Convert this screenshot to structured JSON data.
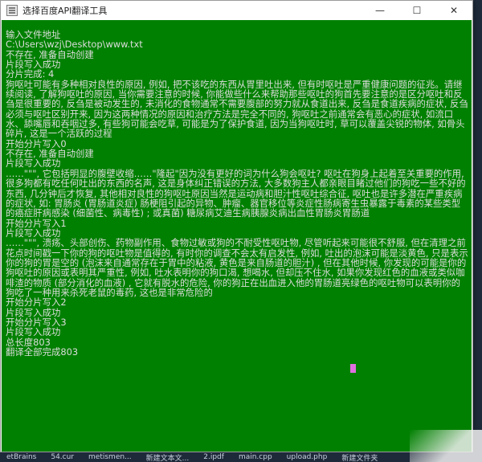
{
  "window": {
    "title": "选择百度API翻译工具"
  },
  "controls": {
    "minimize": "—",
    "maximize": "☐",
    "close": "✕"
  },
  "console": {
    "lines": [
      "输入文件地址",
      "C:\\Users\\wzj\\Desktop\\www.txt",
      "不存在, 准备自动创建",
      "片段写入成功",
      "分片完成: 4",
      "狗呕吐可能有多种相对良性的原因, 例如, 把不该吃的东西从胃里吐出来, 但有时呕吐是严重健康问题的征兆。请继续阅读, 了解狗呕吐的原因, 当你需要注意的时候, 你能做些什么来帮助那些呕吐的狗首先要注意的是区分呕吐和反刍是很重要的, 反刍是被动发生的, 未消化的食物通常不需要腹部的努力就从食道出来, 反刍是食道疾病的症状, 反刍必须与呕吐区别开来, 因为这两种情况的原因和治疗方法是完全不同的, 狗呕吐之前通常会有恶心的症状, 如流口水、舔嘴唇和吞咽过多, 有些狗可能会吃草, 可能是为了保护食道, 因为当狗呕吐时, 草可以覆盖尖锐的物体, 如骨头碎片, 这是一个活跃的过程",
      "开始分片写入0",
      "不存在, 准备自动创建",
      "片段写入成功",
      "……\"\"\", 它包括明显的腹壁收缩……\"隆起\"因为没有更好的词为什么狗会呕吐? 呕吐在狗身上起着至关重要的作用, 很多狗都有吃任何吐出的东西的名声, 这是身体纠正错误的方法, 大多数狗主人都亲眼目睹过他们的狗吃一些不好的东西, 几分钟后才恢复, 其他相对良性的狗呕吐原因当然是运动病和胆汁性呕吐综合征, 呕吐也是许多潜在严重疾病的症状, 如: 胃肠炎 (胃肠道炎症) 肠梗阻引起的异物、肿瘤、器官移位等炎症性肠病寄生虫暴露于毒素的某些类型的癌症肝病感染 (细菌性、病毒性) ; 或真菌) 糖尿病艾迪生病胰腺炎病出血性胃肠炎胃肠道",
      "开始分片写入1",
      "片段写入成功",
      "……\"\"\", 溃疡、头部创伤、药物副作用、食物过敏或狗的不耐受性呕吐物, 尽管听起来可能很不舒服, 但在清理之前花点时间戳一下你的狗的呕吐物是值得的, 有时你的调查不会太有启发性, 例如, 吐出的泡沫可能是淡黄色, 只是表示你的狗的胃是空的 (泡沫来自通常存在于胃中的粘液, 黄色是来自肠道的胆汁) , 但在其他时候, 你发现的可能是你的狗呕吐的原因或表明其严重性, 例如, 吐水表明你的狗口渴, 想喝水, 但却压不住水, 如果你发现红色的血液或类似咖啡渣的物质 (部分消化的血液) , 它就有脱水的危险, 你的狗正在出血进入他的胃肠道亮绿色的呕吐物可以表明你的狗吃了一种用来杀死老鼠的毒药, 这也是非常危险的",
      "开始分片写入2",
      "片段写入成功",
      "开始分片写入3",
      "片段写入成功",
      "总长度803",
      "翻译全部完成803"
    ]
  },
  "taskbar": {
    "items": [
      "etBrains",
      "54.cur",
      "metismen...",
      "新建文本文...",
      "2.ipdf",
      "main.cpp",
      "upload.php",
      "新建文件夹"
    ]
  },
  "colors": {
    "console_bg": "#008000",
    "console_fg": "#dcdcdc",
    "cursor": "#e070e0"
  }
}
